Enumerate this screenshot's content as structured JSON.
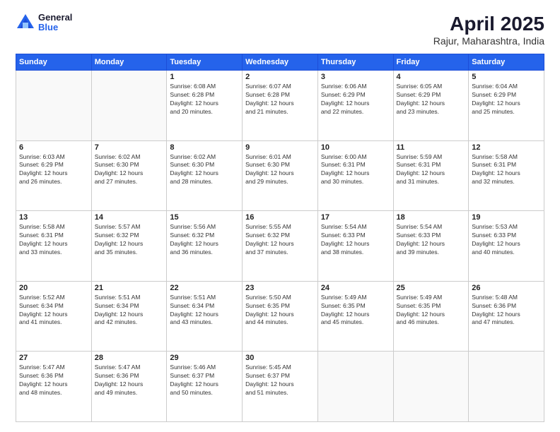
{
  "logo": {
    "general": "General",
    "blue": "Blue"
  },
  "title": {
    "month_year": "April 2025",
    "location": "Rajur, Maharashtra, India"
  },
  "days_of_week": [
    "Sunday",
    "Monday",
    "Tuesday",
    "Wednesday",
    "Thursday",
    "Friday",
    "Saturday"
  ],
  "weeks": [
    [
      {
        "day": "",
        "info": ""
      },
      {
        "day": "",
        "info": ""
      },
      {
        "day": "1",
        "info": "Sunrise: 6:08 AM\nSunset: 6:28 PM\nDaylight: 12 hours\nand 20 minutes."
      },
      {
        "day": "2",
        "info": "Sunrise: 6:07 AM\nSunset: 6:28 PM\nDaylight: 12 hours\nand 21 minutes."
      },
      {
        "day": "3",
        "info": "Sunrise: 6:06 AM\nSunset: 6:29 PM\nDaylight: 12 hours\nand 22 minutes."
      },
      {
        "day": "4",
        "info": "Sunrise: 6:05 AM\nSunset: 6:29 PM\nDaylight: 12 hours\nand 23 minutes."
      },
      {
        "day": "5",
        "info": "Sunrise: 6:04 AM\nSunset: 6:29 PM\nDaylight: 12 hours\nand 25 minutes."
      }
    ],
    [
      {
        "day": "6",
        "info": "Sunrise: 6:03 AM\nSunset: 6:29 PM\nDaylight: 12 hours\nand 26 minutes."
      },
      {
        "day": "7",
        "info": "Sunrise: 6:02 AM\nSunset: 6:30 PM\nDaylight: 12 hours\nand 27 minutes."
      },
      {
        "day": "8",
        "info": "Sunrise: 6:02 AM\nSunset: 6:30 PM\nDaylight: 12 hours\nand 28 minutes."
      },
      {
        "day": "9",
        "info": "Sunrise: 6:01 AM\nSunset: 6:30 PM\nDaylight: 12 hours\nand 29 minutes."
      },
      {
        "day": "10",
        "info": "Sunrise: 6:00 AM\nSunset: 6:31 PM\nDaylight: 12 hours\nand 30 minutes."
      },
      {
        "day": "11",
        "info": "Sunrise: 5:59 AM\nSunset: 6:31 PM\nDaylight: 12 hours\nand 31 minutes."
      },
      {
        "day": "12",
        "info": "Sunrise: 5:58 AM\nSunset: 6:31 PM\nDaylight: 12 hours\nand 32 minutes."
      }
    ],
    [
      {
        "day": "13",
        "info": "Sunrise: 5:58 AM\nSunset: 6:31 PM\nDaylight: 12 hours\nand 33 minutes."
      },
      {
        "day": "14",
        "info": "Sunrise: 5:57 AM\nSunset: 6:32 PM\nDaylight: 12 hours\nand 35 minutes."
      },
      {
        "day": "15",
        "info": "Sunrise: 5:56 AM\nSunset: 6:32 PM\nDaylight: 12 hours\nand 36 minutes."
      },
      {
        "day": "16",
        "info": "Sunrise: 5:55 AM\nSunset: 6:32 PM\nDaylight: 12 hours\nand 37 minutes."
      },
      {
        "day": "17",
        "info": "Sunrise: 5:54 AM\nSunset: 6:33 PM\nDaylight: 12 hours\nand 38 minutes."
      },
      {
        "day": "18",
        "info": "Sunrise: 5:54 AM\nSunset: 6:33 PM\nDaylight: 12 hours\nand 39 minutes."
      },
      {
        "day": "19",
        "info": "Sunrise: 5:53 AM\nSunset: 6:33 PM\nDaylight: 12 hours\nand 40 minutes."
      }
    ],
    [
      {
        "day": "20",
        "info": "Sunrise: 5:52 AM\nSunset: 6:34 PM\nDaylight: 12 hours\nand 41 minutes."
      },
      {
        "day": "21",
        "info": "Sunrise: 5:51 AM\nSunset: 6:34 PM\nDaylight: 12 hours\nand 42 minutes."
      },
      {
        "day": "22",
        "info": "Sunrise: 5:51 AM\nSunset: 6:34 PM\nDaylight: 12 hours\nand 43 minutes."
      },
      {
        "day": "23",
        "info": "Sunrise: 5:50 AM\nSunset: 6:35 PM\nDaylight: 12 hours\nand 44 minutes."
      },
      {
        "day": "24",
        "info": "Sunrise: 5:49 AM\nSunset: 6:35 PM\nDaylight: 12 hours\nand 45 minutes."
      },
      {
        "day": "25",
        "info": "Sunrise: 5:49 AM\nSunset: 6:35 PM\nDaylight: 12 hours\nand 46 minutes."
      },
      {
        "day": "26",
        "info": "Sunrise: 5:48 AM\nSunset: 6:36 PM\nDaylight: 12 hours\nand 47 minutes."
      }
    ],
    [
      {
        "day": "27",
        "info": "Sunrise: 5:47 AM\nSunset: 6:36 PM\nDaylight: 12 hours\nand 48 minutes."
      },
      {
        "day": "28",
        "info": "Sunrise: 5:47 AM\nSunset: 6:36 PM\nDaylight: 12 hours\nand 49 minutes."
      },
      {
        "day": "29",
        "info": "Sunrise: 5:46 AM\nSunset: 6:37 PM\nDaylight: 12 hours\nand 50 minutes."
      },
      {
        "day": "30",
        "info": "Sunrise: 5:45 AM\nSunset: 6:37 PM\nDaylight: 12 hours\nand 51 minutes."
      },
      {
        "day": "",
        "info": ""
      },
      {
        "day": "",
        "info": ""
      },
      {
        "day": "",
        "info": ""
      }
    ]
  ]
}
